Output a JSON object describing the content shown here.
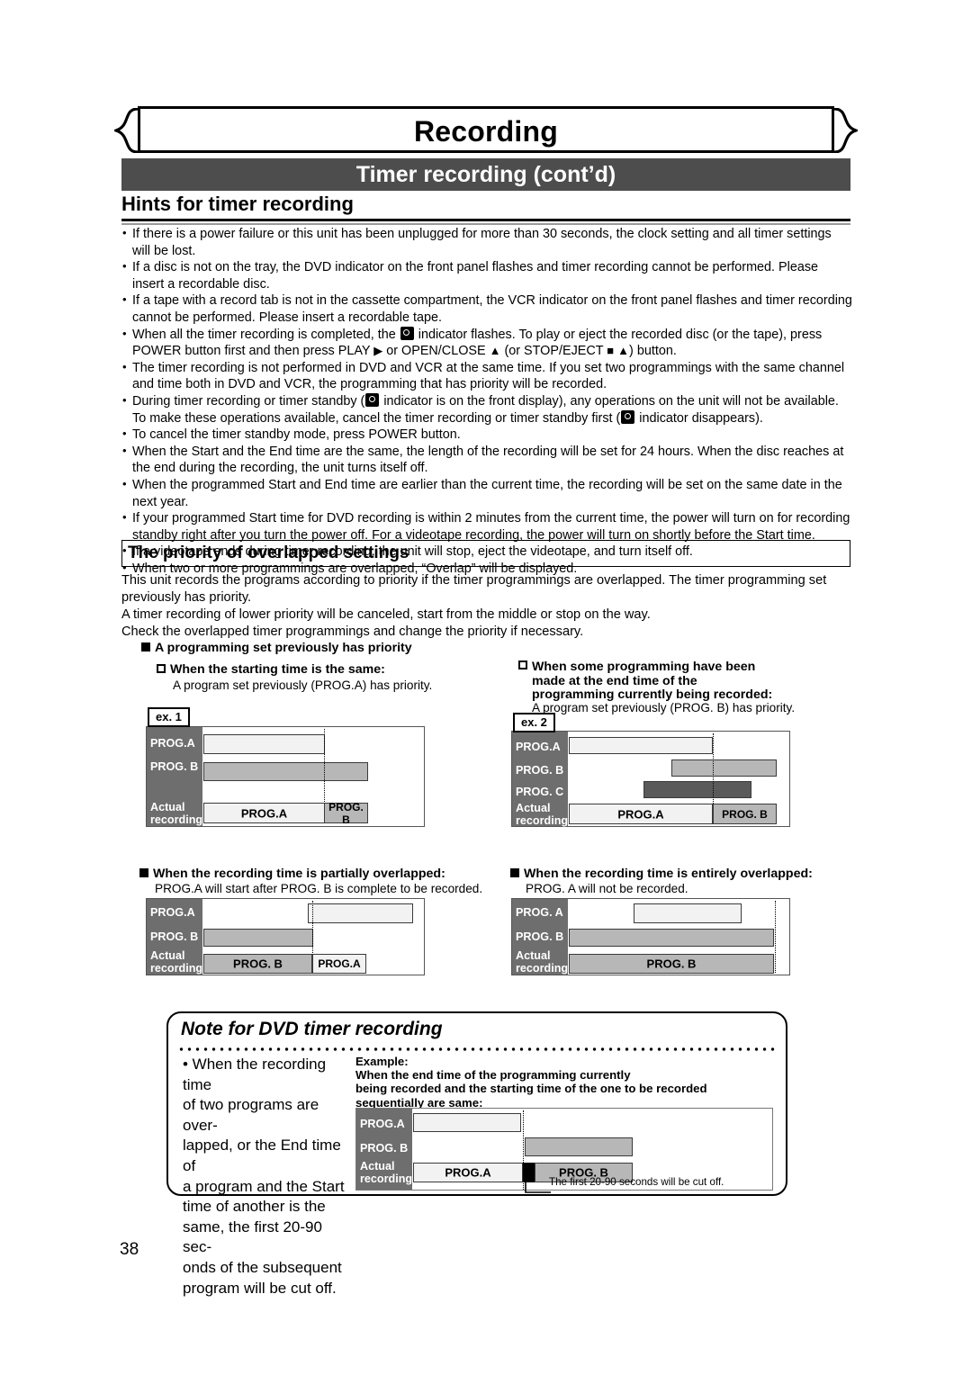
{
  "header": {
    "banner_title": "Recording",
    "subtitle_bar": "Timer recording (cont’d)",
    "section_heading": "Hints for timer recording"
  },
  "hints": [
    "If there is a power failure or this unit has been unplugged for more than 30 seconds, the clock setting and all timer settings will be lost.",
    "If a disc is not on the tray, the DVD indicator on the front panel flashes and timer recording cannot be performed. Please insert a recordable disc.",
    "If a tape with a record tab is not in the cassette compartment, the VCR indicator on the front panel flashes and timer recording cannot be performed. Please insert a recordable tape.",
    "When all the timer recording is completed, the [timer-icon] indicator flashes. To play or eject the recorded disc (or the tape), press POWER button first and then press PLAY ▶ or OPEN/CLOSE ▲ (or STOP/EJECT ■ ▲) button.",
    "The timer recording is not performed in DVD and VCR at the same time. If you set two programmings with the same channel and time both in DVD and VCR, the programming that has priority will be recorded.",
    "During timer recording or timer standby ([timer-icon] indicator is on the front display), any operations on the unit will not be available. To make these operations available, cancel the timer recording or timer standby first ([timer-icon] indicator disappears).",
    "To cancel the timer standby mode, press POWER button.",
    "When the Start and the End time are the same, the length of the recording will be set for 24 hours. When the disc reaches at the end during the recording, the unit turns itself off.",
    "When the programmed Start and End time are earlier than the current time, the recording will be set on the same date in the next year.",
    "If your programmed Start time for DVD recording is within 2 minutes from the current time, the power will turn on for recording standby right after you turn the power off. For a videotape recording, the power will turn on shortly before the Start time.",
    "If a videotape ends during timer recording, the unit will stop, eject the videotape, and turn itself off.",
    "When two or more programmings are overlapped, “Overlap” will be displayed."
  ],
  "hints_html": [
    "If there is a power failure or this unit has been unplugged for more than 30 seconds, the clock setting and all timer settings will be lost.",
    "If a disc is not on the tray, the DVD indicator on the front panel flashes and timer recording cannot be performed. Please insert a recordable disc.",
    "If a tape with a record tab is not in the cassette compartment, the VCR indicator on the front panel flashes and timer recording cannot be performed. Please insert a recordable tape.",
    "When all the timer recording is completed, the  <span class='ico'></span>  indicator flashes. To play or eject the recorded disc (or the tape), press POWER button first and then press PLAY <span class='glyph'>▶</span> or OPEN/CLOSE <span class='glyph'>▲</span> (or STOP/EJECT <span class='glyph'>■</span> <span class='glyph'>▲</span>) button.",
    "The timer recording is not performed in DVD and VCR at the same time. If you set two programmings with the same channel and time both in DVD and VCR, the programming that has priority will be recorded.",
    "During timer recording or timer standby (<span class='ico'></span> indicator is on the front display), any operations on the unit will not be available. To make these operations available, cancel the timer recording or timer standby first (<span class='ico'></span> indicator disappears).",
    "To cancel the timer standby mode, press POWER button.",
    "When the Start and the End time are the same, the length of the recording will be set for 24 hours. When the disc reaches at the end during the recording, the unit turns itself off.",
    "When the programmed Start and End time are earlier than the current time, the recording will be set on the same date in the next year.",
    "If your programmed Start time for DVD recording is within 2 minutes from the current time, the power will turn on for recording standby right after you turn the power off. For a videotape recording, the power will turn on shortly before the Start time.",
    "If a videotape ends during timer recording, the unit will stop, eject the videotape, and turn itself off.",
    "When two or more programmings are overlapped, “Overlap” will be displayed."
  ],
  "priority": {
    "box_heading": "The priority of overlapped settings",
    "para1": "This unit records the programs according to priority if the timer programmings are overlapped. The timer programming set previously has priority.",
    "para2": "A timer recording of lower priority will be canceled, start from the middle or stop on the way.",
    "para3": "Check the overlapped timer programmings and change the priority if necessary.",
    "sq_heading": "A programming set previously has priority"
  },
  "cases": {
    "case1": {
      "heading": "When the starting time is the same:",
      "caption": "A program set previously (PROG.A) has priority.",
      "badge": "ex. 1",
      "rows": [
        "PROG.A",
        "PROG. B",
        "Actual recording"
      ],
      "actual_segments": [
        "PROG.A",
        "PROG. B"
      ]
    },
    "case2": {
      "heading_line1": "When some programming have been",
      "heading_line2": "made at the end time of the",
      "heading_line3": "programming currently being recorded:",
      "caption": "A program set previously (PROG. B) has priority.",
      "badge": "ex. 2",
      "rows": [
        "PROG.A",
        "PROG. B",
        "PROG. C",
        "Actual recording"
      ],
      "actual_segments": [
        "PROG.A",
        "PROG. B"
      ]
    },
    "case3": {
      "heading": "When the recording time is partially overlapped:",
      "caption": "PROG.A will start after PROG. B is complete to be recorded.",
      "rows": [
        "PROG.A",
        "PROG. B",
        "Actual recording"
      ],
      "actual_segments": [
        "PROG. B",
        "PROG.A"
      ]
    },
    "case4": {
      "heading": "When the recording time is entirely overlapped:",
      "caption": "PROG. A will not be recorded.",
      "rows": [
        "PROG. A",
        "PROG. B",
        "Actual recording"
      ],
      "actual_segments": [
        "PROG. B"
      ]
    }
  },
  "note": {
    "title": "Note for DVD timer recording",
    "left_text": "• When the recording time of two programs are over-lapped, or the End time of a program and the Start time of another is the same, the first 20-90 sec-onds of the subsequent program will be cut off.",
    "left_lines": [
      "• When the recording time",
      "of two programs are over-",
      "lapped, or the End time of",
      "a program and the Start",
      "time of another is the",
      "same, the first 20-90 sec-",
      "onds of the subsequent",
      "program will be cut off."
    ],
    "example_label": "Example:",
    "example_line1": "When the end time of the programming currently",
    "example_line2": "being recorded and the starting time of the one to be recorded",
    "example_line3": "sequentially are same:",
    "rows": [
      "PROG.A",
      "PROG. B",
      "Actual recording"
    ],
    "actual_segments": [
      "PROG.A",
      "PROG. B"
    ],
    "footnote": "The first 20-90 seconds will be cut off."
  },
  "page_number": "38",
  "colors": {
    "bar_dark": "#4d4d4d",
    "label_col": "#6e6e6e",
    "bar_white": "#f2f2f2",
    "bar_gray": "#b7b7b7",
    "bar_darkgray": "#5a5a5a",
    "bar_black": "#000000"
  }
}
